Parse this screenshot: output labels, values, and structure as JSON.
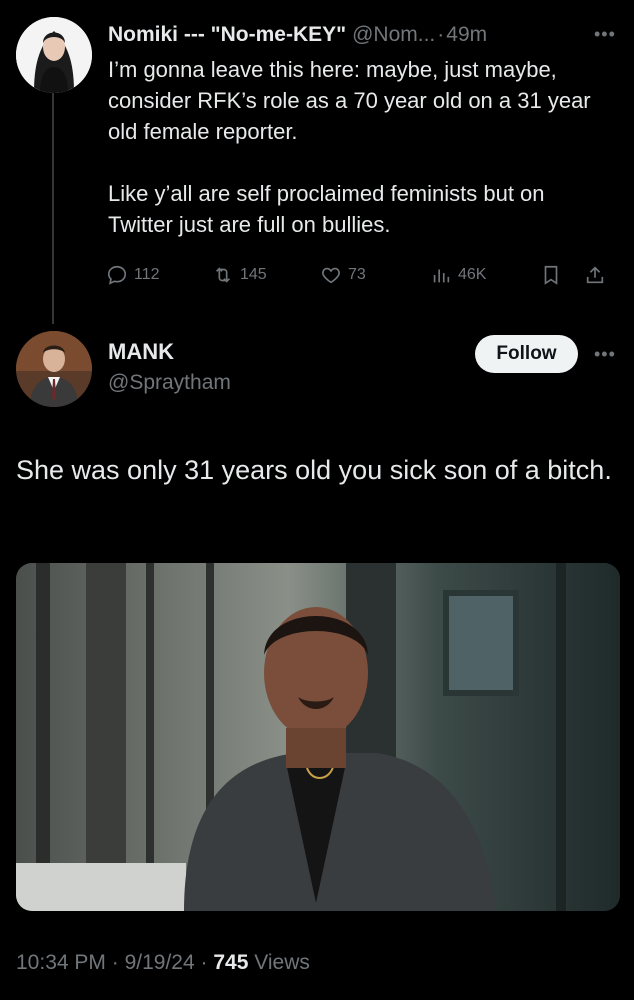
{
  "tweet1": {
    "name": "Nomiki --- \"No-me-KEY\"",
    "handle": "@Nom...",
    "separator": "·",
    "time": "49m",
    "paragraphs": [
      "I’m gonna leave this here: maybe, just maybe, consider RFK’s role as a 70 year old on a 31 year old female reporter.",
      "Like y’all are self proclaimed feminists but on Twitter just are full on bullies."
    ],
    "actions": {
      "replies": "112",
      "reposts": "145",
      "likes": "73",
      "views": "46K"
    }
  },
  "tweet2": {
    "name": "MANK",
    "handle": "@Spraytham",
    "follow_label": "Follow",
    "text": "She was only 31 years old you sick son of a bitch."
  },
  "footer": {
    "time": "10:34 PM",
    "date": "9/19/24",
    "views_count": "745",
    "views_label": "Views",
    "separator": "·"
  },
  "icons": {
    "more": "more-horizontal-icon",
    "reply": "reply-icon",
    "repost": "repost-icon",
    "like": "heart-icon",
    "views": "views-chart-icon",
    "bookmark": "bookmark-icon",
    "share": "share-icon"
  },
  "colors": {
    "background": "#000000",
    "text": "#e7e9ea",
    "muted": "#71767b",
    "follow_bg": "#eff3f4"
  }
}
